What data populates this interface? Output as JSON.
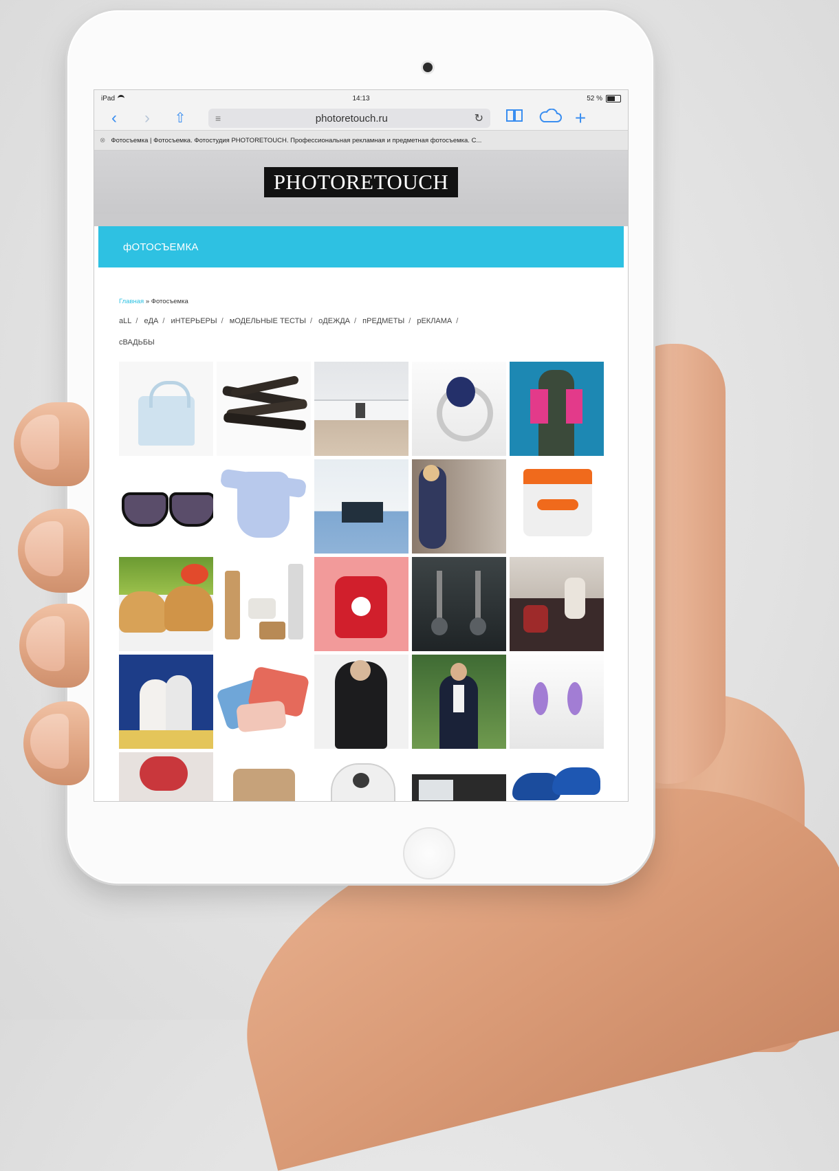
{
  "device": {
    "name": "iPad"
  },
  "status_bar": {
    "carrier": "iPad",
    "time": "14:13",
    "battery": "52 %"
  },
  "browser": {
    "url": "photoretouch.ru",
    "tab_title": "Фотосъемка | Фотосъемка. Фотостудия PHOTORETOUCH. Профессиональная рекламная и предметная фотосъемка. С...",
    "buttons": {
      "back": "‹",
      "forward": "›",
      "share": "⇧",
      "reader": "≡",
      "reload": "↻",
      "bookmarks": "📖",
      "cloud": "☁",
      "new_tab": "+"
    }
  },
  "site": {
    "logo": "PHOTORETOUCH",
    "section_title": "фОТОСЪЕМКА",
    "breadcrumb": {
      "home": "Главная",
      "separator": "»",
      "current": "Фотосъемка"
    },
    "filters": [
      "aLL",
      "еДА",
      "иНТЕРЬЕРЫ",
      "мОДЕЛЬНЫЕ ТЕСТЫ",
      "оДЕЖДА",
      "пРЕДМЕТЫ",
      "рЕКЛАМА",
      "сВАДЬБЫ"
    ],
    "filter_separator": "/",
    "accent_color": "#2ec1e2"
  },
  "gallery": [
    {
      "name": "handbag"
    },
    {
      "name": "vanilla-pods"
    },
    {
      "name": "kitchen-interior"
    },
    {
      "name": "sapphire-ring"
    },
    {
      "name": "fashion-jacket"
    },
    {
      "name": "sunglasses"
    },
    {
      "name": "baby-bodysuit"
    },
    {
      "name": "office-interior"
    },
    {
      "name": "fashion-model-sitting"
    },
    {
      "name": "cosmetic-jar"
    },
    {
      "name": "croissant-sandwiches"
    },
    {
      "name": "cosmetics-set"
    },
    {
      "name": "teapot-ad"
    },
    {
      "name": "pearl-earrings"
    },
    {
      "name": "group-fashion-shoot"
    },
    {
      "name": "wedding-couple"
    },
    {
      "name": "scarves"
    },
    {
      "name": "fur-coat"
    },
    {
      "name": "man-in-blazer"
    },
    {
      "name": "amethyst-earrings"
    },
    {
      "name": "couple-portrait"
    },
    {
      "name": "burlap-bag"
    },
    {
      "name": "birdhouse"
    },
    {
      "name": "electronics"
    },
    {
      "name": "blue-sneakers"
    }
  ]
}
